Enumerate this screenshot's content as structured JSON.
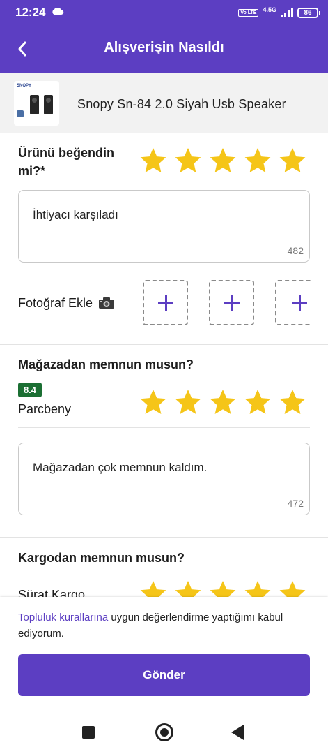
{
  "status_bar": {
    "time": "12:24",
    "network": "4.5G",
    "volte": "Vo LTE",
    "battery": "86"
  },
  "app_bar": {
    "title": "Alışverişin Nasıldı",
    "back_icon": "chevron-left-icon"
  },
  "product": {
    "name": "Snopy  Sn-84 2.0 Siyah  Usb Speaker",
    "brand": "SNOPY"
  },
  "product_rating": {
    "question": "Ürünü beğendin mi?*",
    "stars": 5,
    "star_color": "#f5c518",
    "comment": "İhtiyacı karşıladı",
    "remaining_chars": "482"
  },
  "photo": {
    "label": "Fotoğraf Ekle",
    "icon": "camera-icon",
    "slots": 3
  },
  "store_rating": {
    "question": "Mağazadan memnun musun?",
    "score": "8.4",
    "score_color": "#1b6f33",
    "store_name": "Parcbeny",
    "stars": 5,
    "comment": "Mağazadan çok memnun kaldım.",
    "remaining_chars": "472"
  },
  "cargo_rating": {
    "question": "Kargodan memnun musun?",
    "company": "Sürat Kargo",
    "stars": 5
  },
  "footer": {
    "terms_link": "Topluluk kurallarına",
    "terms_text": " uygun değerlendirme yaptığımı kabul ediyorum.",
    "submit_label": "Gönder"
  },
  "colors": {
    "primary": "#5c3ec2",
    "background": "#ffffff",
    "panel": "#f2f2f2"
  }
}
